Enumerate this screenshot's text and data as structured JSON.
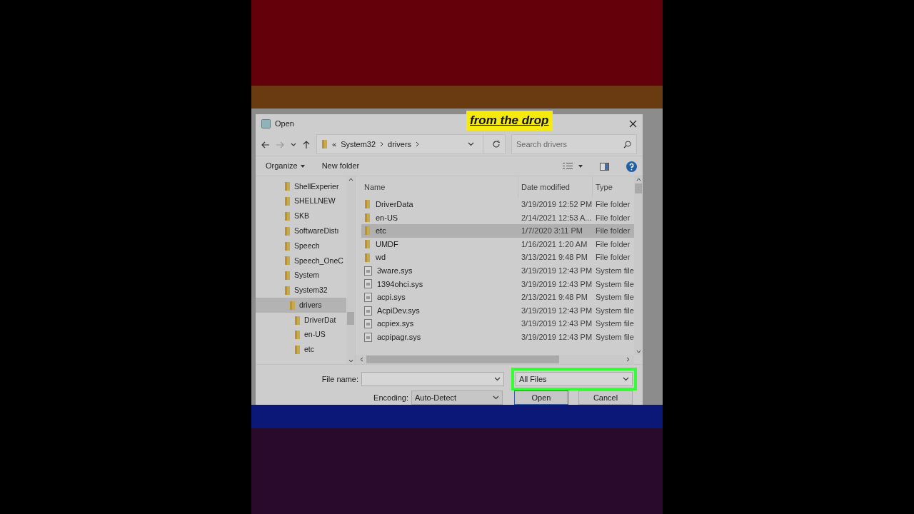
{
  "caption": "from the drop",
  "dialog": {
    "title": "Open"
  },
  "address": {
    "crumbs": [
      "System32",
      "drivers"
    ],
    "overflow": "«"
  },
  "search": {
    "placeholder": "Search drivers"
  },
  "toolbar": {
    "organize": "Organize",
    "new_folder": "New folder"
  },
  "tree": [
    {
      "label": "ShellExperier",
      "selected": false
    },
    {
      "label": "SHELLNEW",
      "selected": false
    },
    {
      "label": "SKB",
      "selected": false
    },
    {
      "label": "SoftwareDistı",
      "selected": false
    },
    {
      "label": "Speech",
      "selected": false
    },
    {
      "label": "Speech_OneC",
      "selected": false
    },
    {
      "label": "System",
      "selected": false
    },
    {
      "label": "System32",
      "selected": false,
      "children": [
        {
          "label": "drivers",
          "selected": true,
          "children": [
            {
              "label": "DriverDat",
              "selected": false
            },
            {
              "label": "en-US",
              "selected": false
            },
            {
              "label": "etc",
              "selected": false
            }
          ]
        }
      ]
    }
  ],
  "table": {
    "columns": [
      "Name",
      "Date modified",
      "Type"
    ],
    "rows": [
      {
        "kind": "folder",
        "name": "DriverData",
        "date": "3/19/2019 12:52 PM",
        "type": "File folder",
        "selected": false
      },
      {
        "kind": "folder",
        "name": "en-US",
        "date": "2/14/2021 12:53 A...",
        "type": "File folder",
        "selected": false
      },
      {
        "kind": "folder",
        "name": "etc",
        "date": "1/7/2020 3:11 PM",
        "type": "File folder",
        "selected": true
      },
      {
        "kind": "folder",
        "name": "UMDF",
        "date": "1/16/2021 1:20 AM",
        "type": "File folder",
        "selected": false
      },
      {
        "kind": "folder",
        "name": "wd",
        "date": "3/13/2021 9:48 PM",
        "type": "File folder",
        "selected": false
      },
      {
        "kind": "file",
        "name": "3ware.sys",
        "date": "3/19/2019 12:43 PM",
        "type": "System file",
        "selected": false
      },
      {
        "kind": "file",
        "name": "1394ohci.sys",
        "date": "3/19/2019 12:43 PM",
        "type": "System file",
        "selected": false
      },
      {
        "kind": "file",
        "name": "acpi.sys",
        "date": "2/13/2021 9:48 PM",
        "type": "System file",
        "selected": false
      },
      {
        "kind": "file",
        "name": "AcpiDev.sys",
        "date": "3/19/2019 12:43 PM",
        "type": "System file",
        "selected": false
      },
      {
        "kind": "file",
        "name": "acpiex.sys",
        "date": "3/19/2019 12:43 PM",
        "type": "System file",
        "selected": false
      },
      {
        "kind": "file",
        "name": "acpipagr.sys",
        "date": "3/19/2019 12:43 PM",
        "type": "System file",
        "selected": false
      }
    ]
  },
  "file_name": {
    "label": "File name:"
  },
  "file_type": {
    "value": "All Files",
    "highlighted": true
  },
  "encoding": {
    "label": "Encoding:",
    "value": "Auto-Detect"
  },
  "buttons": [
    {
      "kind": "primary",
      "label": "Open"
    },
    {
      "kind": "normal",
      "label": "Cancel"
    }
  ]
}
